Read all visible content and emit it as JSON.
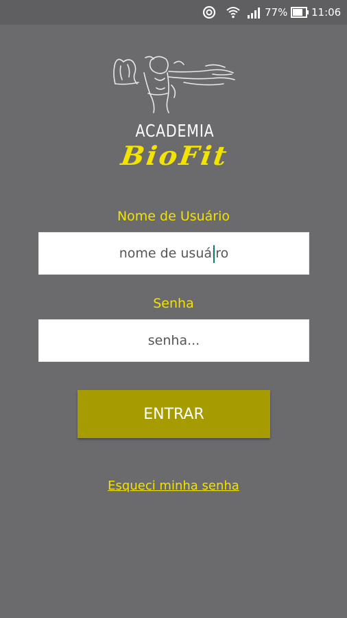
{
  "status_bar": {
    "battery_percent": "77%",
    "time": "11:06",
    "icons": [
      "sync-icon",
      "wifi-icon",
      "signal-icon",
      "battery-icon"
    ]
  },
  "logo": {
    "line1": "ACADEMIA",
    "line2": "BioFit"
  },
  "login": {
    "username_label": "Nome de Usuário",
    "username_value": "",
    "username_placeholder": "nome de usuáiro",
    "password_label": "Senha",
    "password_value": "",
    "password_placeholder": "senha...",
    "submit_label": "ENTRAR",
    "forgot_password_label": "Esqueci minha senha"
  },
  "colors": {
    "background": "#6b6b6e",
    "accent_yellow": "#f2e300",
    "button": "#a69b00"
  }
}
